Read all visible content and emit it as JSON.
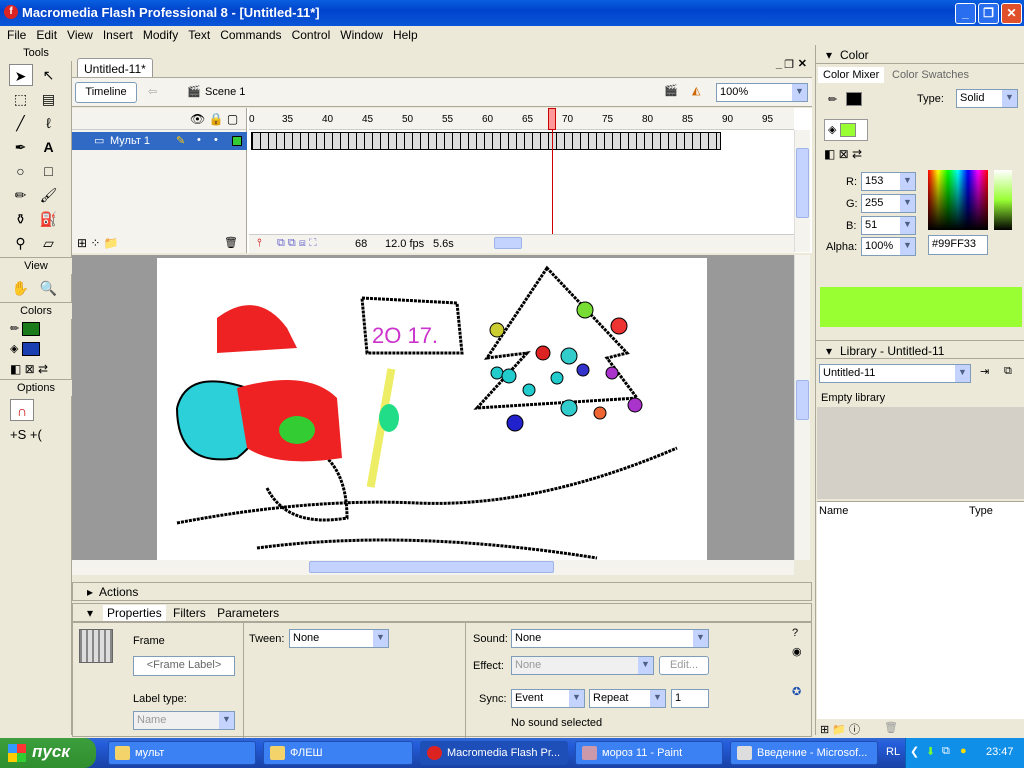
{
  "window": {
    "title": "Macromedia Flash Professional 8 - [Untitled-11*]"
  },
  "menu": [
    "File",
    "Edit",
    "View",
    "Insert",
    "Modify",
    "Text",
    "Commands",
    "Control",
    "Window",
    "Help"
  ],
  "tools": {
    "title": "Tools",
    "view_label": "View",
    "colors_label": "Colors",
    "options_label": "Options",
    "stroke_color": "#1a7a1a",
    "fill_color": "#1a3fb0"
  },
  "document": {
    "tab": "Untitled-11*",
    "timeline_button": "Timeline",
    "scene": "Scene 1",
    "zoom": "100%"
  },
  "timeline": {
    "ruler": [
      "0",
      "35",
      "40",
      "45",
      "50",
      "55",
      "60",
      "65",
      "70",
      "75",
      "80",
      "85",
      "90",
      "95"
    ],
    "layer": "Мульт 1",
    "current_frame": "68",
    "fps": "12.0 fps",
    "time": "5.6s"
  },
  "panels": {
    "actions": "Actions",
    "tabs": [
      "Properties",
      "Filters",
      "Parameters"
    ],
    "props": {
      "frame": "Frame",
      "frame_label_placeholder": "<Frame Label>",
      "label_type": "Label type:",
      "label_type_value": "Name",
      "tween_label": "Tween:",
      "tween": "None",
      "sound_label": "Sound:",
      "sound": "None",
      "effect_label": "Effect:",
      "effect": "None",
      "edit": "Edit...",
      "sync_label": "Sync:",
      "sync": "Event",
      "repeat": "Repeat",
      "repeat_count": "1",
      "no_sound": "No sound selected"
    }
  },
  "color": {
    "title": "Color",
    "tabs": [
      "Color Mixer",
      "Color Swatches"
    ],
    "type_label": "Type:",
    "type": "Solid",
    "r_label": "R:",
    "r": "153",
    "g_label": "G:",
    "g": "255",
    "b_label": "B:",
    "b": "51",
    "alpha_label": "Alpha:",
    "alpha": "100%",
    "hex": "#99FF33"
  },
  "library": {
    "title": "Library - Untitled-11",
    "select": "Untitled-11",
    "empty": "Empty library",
    "col_name": "Name",
    "col_type": "Type"
  },
  "taskbar": {
    "start": "пуск",
    "tasks": [
      "мульт",
      "ФЛЕШ",
      "Macromedia Flash Pr...",
      "мороз 11 - Paint",
      "Введение - Microsof..."
    ],
    "lang": "RL",
    "clock": "23:47"
  }
}
